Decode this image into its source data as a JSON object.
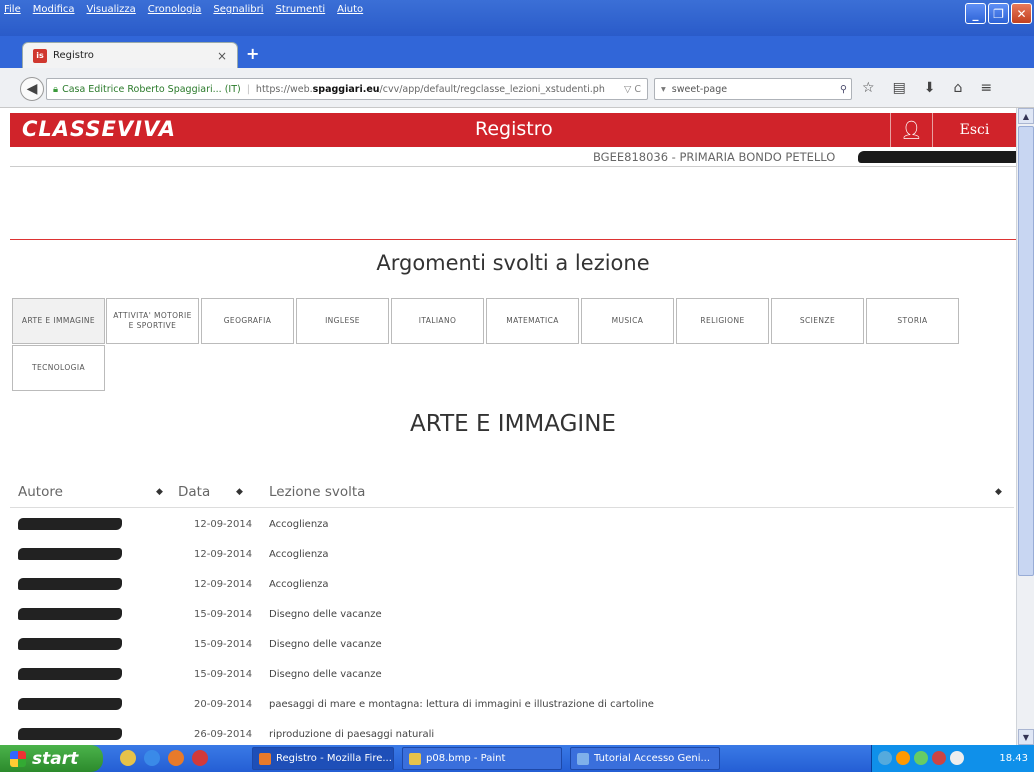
{
  "browser": {
    "menus": [
      "File",
      "Modifica",
      "Visualizza",
      "Cronologia",
      "Segnalibri",
      "Strumenti",
      "Aiuto"
    ],
    "tab_title": "Registro",
    "tab_close": "×",
    "new_tab": "+",
    "url_identity": "Casa Editrice Roberto Spaggiari... (IT)",
    "url_pre": "https://web.",
    "url_domain": "spaggiari.eu",
    "url_post": "/cvv/app/default/regclasse_lezioni_xstudenti.ph",
    "url_end": "▽ C",
    "search_text": "sweet-page",
    "search_engine": "▾"
  },
  "site": {
    "logo": "CLASSEVIVA",
    "title": "Registro",
    "logout": "Esci",
    "school": "BGEE818036 - PRIMARIA BONDO PETELLO",
    "page_heading": "Argomenti svolti a lezione",
    "selected_subject": "ARTE E IMMAGINE"
  },
  "subjects": [
    "ARTE E IMMAGINE",
    "ATTIVITA' MOTORIE E SPORTIVE",
    "GEOGRAFIA",
    "INGLESE",
    "ITALIANO",
    "MATEMATICA",
    "MUSICA",
    "RELIGIONE",
    "SCIENZE",
    "STORIA",
    "TECNOLOGIA"
  ],
  "table": {
    "headers": {
      "autore": "Autore",
      "data": "Data",
      "lezione": "Lezione svolta",
      "sort": "◆"
    },
    "rows": [
      {
        "data": "12-09-2014",
        "lezione": "Accoglienza"
      },
      {
        "data": "12-09-2014",
        "lezione": "Accoglienza"
      },
      {
        "data": "12-09-2014",
        "lezione": "Accoglienza"
      },
      {
        "data": "15-09-2014",
        "lezione": "Disegno delle vacanze"
      },
      {
        "data": "15-09-2014",
        "lezione": "Disegno delle vacanze"
      },
      {
        "data": "15-09-2014",
        "lezione": "Disegno delle vacanze"
      },
      {
        "data": "20-09-2014",
        "lezione": "paesaggi di mare e montagna: lettura di immagini e illustrazione di cartoline"
      },
      {
        "data": "26-09-2014",
        "lezione": "riproduzione di paesaggi naturali"
      }
    ]
  },
  "taskbar": {
    "start": "start",
    "items": [
      "Registro - Mozilla Fire...",
      "p08.bmp - Paint",
      "Tutorial Accesso Geni..."
    ],
    "clock": "18.43"
  },
  "colors": {
    "brand_red": "#d0232a",
    "xp_blue": "#245ed4",
    "start_green": "#3a9e3a"
  }
}
